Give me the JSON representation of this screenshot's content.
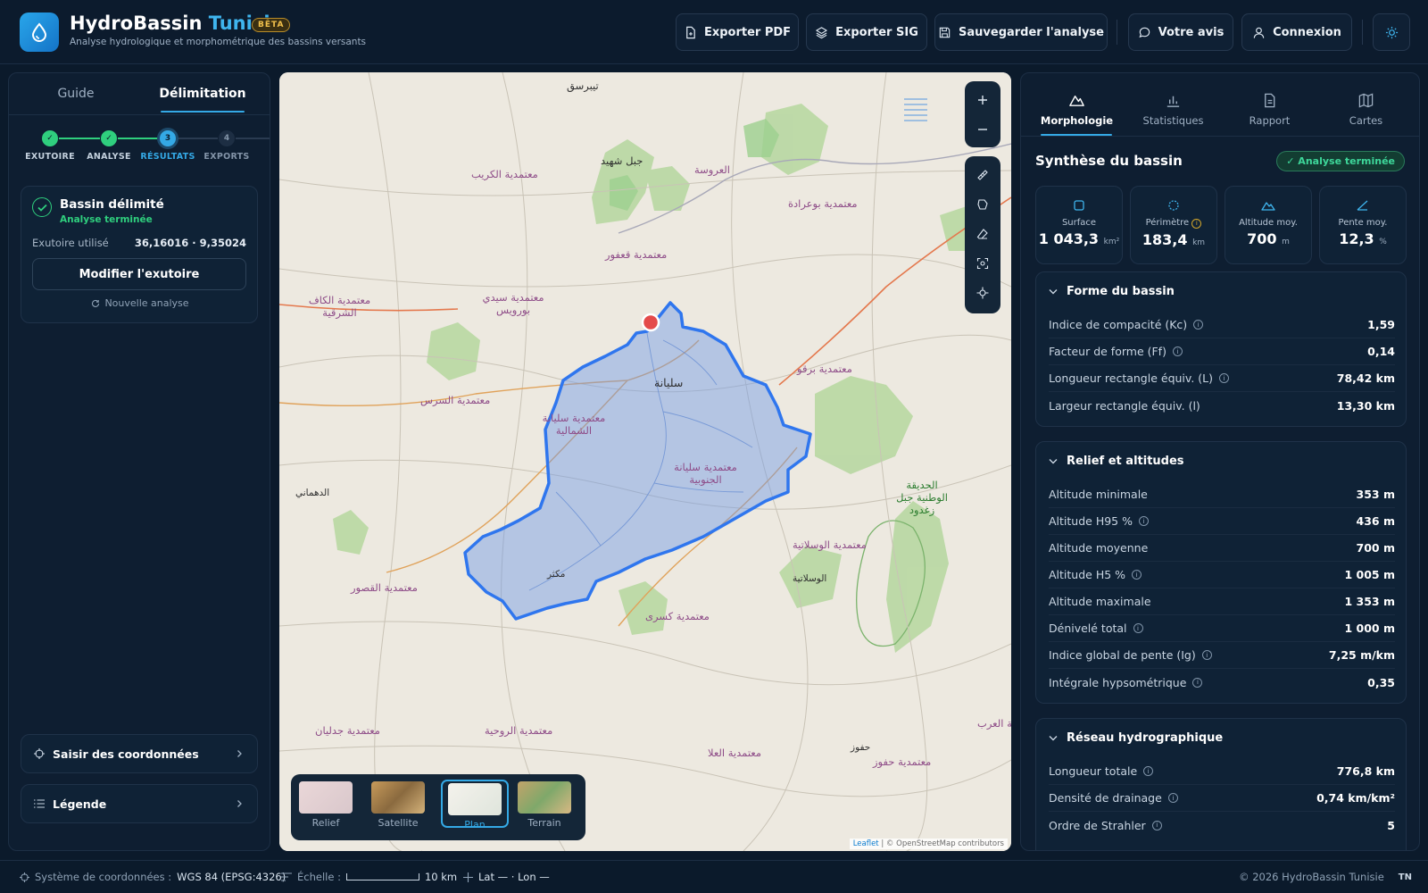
{
  "header": {
    "title_main": "HydroBassin",
    "title_accent": "Tunisie",
    "badge": "BÊTA",
    "subtitle": "Analyse hydrologique et morphométrique des bassins versants",
    "buttons": {
      "export_pdf": "Exporter PDF",
      "export_sig": "Exporter SIG",
      "save": "Sauvegarder l'analyse",
      "feedback": "Votre avis",
      "login": "Connexion"
    }
  },
  "left": {
    "tabs": [
      "Guide",
      "Délimitation"
    ],
    "steps": [
      {
        "n": "✓",
        "label": "EXUTOIRE"
      },
      {
        "n": "✓",
        "label": "ANALYSE"
      },
      {
        "n": "3",
        "label": "RÉSULTATS"
      },
      {
        "n": "4",
        "label": "EXPORTS"
      }
    ],
    "result": {
      "title": "Bassin délimité",
      "status": "Analyse terminée",
      "outlet_label": "Exutoire utilisé",
      "outlet_value": "36,16016 · 9,35024",
      "modify_button": "Modifier l'exutoire",
      "new_analysis": "Nouvelle analyse"
    },
    "coords_button": "Saisir des coordonnées",
    "legend_button": "Légende"
  },
  "map": {
    "labels": [
      "تيبرسق",
      "جبل شهيد",
      "العروسة",
      "معتمدية الكريب",
      "معتمدية بوعرادة",
      "معتمدية قعفور",
      "معتمدية سيدي بورويس",
      "معتمدية الكاف الشرقية",
      "سليانة",
      "معتمدية برقو",
      "معتمدية السرس",
      "معتمدية سليانة الشمالية",
      "معتمدية سليانة الجنوبية",
      "الدهماني",
      "الحديقة الوطنية جبل زغدود",
      "معتمدية الوسلاتية",
      "الوسلاتية",
      "مكثر",
      "معتمدية القصور",
      "معتمدية كسرى",
      "معتمدية جدليان",
      "معتمدية الروحية",
      "معتمدية العلا",
      "حفوز",
      "معتمدية حفوز",
      "معتمدية العرب"
    ],
    "basemaps": [
      "Relief",
      "Satellite",
      "Plan",
      "Terrain"
    ],
    "active_basemap": "Plan",
    "attribution_leaflet": "Leaflet",
    "attribution_osm": "| © OpenStreetMap contributors"
  },
  "right": {
    "tabs": [
      "Morphologie",
      "Statistiques",
      "Rapport",
      "Cartes"
    ],
    "title": "Synthèse du bassin",
    "badge": "✓ Analyse terminée",
    "stats": [
      {
        "label": "Surface",
        "value": "1 043,3",
        "unit": "km²"
      },
      {
        "label": "Périmètre",
        "value": "183,4",
        "unit": "km"
      },
      {
        "label": "Altitude moy.",
        "value": "700",
        "unit": "m"
      },
      {
        "label": "Pente moy.",
        "value": "12,3",
        "unit": "%"
      }
    ],
    "sections": [
      {
        "title": "Forme du bassin",
        "rows": [
          {
            "k": "Indice de compacité (Kc)",
            "v": "1,59"
          },
          {
            "k": "Facteur de forme (Ff)",
            "v": "0,14"
          },
          {
            "k": "Longueur rectangle équiv. (L)",
            "v": "78,42 km"
          },
          {
            "k": "Largeur rectangle équiv. (l)",
            "v": "13,30 km"
          }
        ]
      },
      {
        "title": "Relief et altitudes",
        "rows": [
          {
            "k": "Altitude minimale",
            "v": "353 m"
          },
          {
            "k": "Altitude H95 %",
            "v": "436 m"
          },
          {
            "k": "Altitude moyenne",
            "v": "700 m"
          },
          {
            "k": "Altitude H5 %",
            "v": "1 005 m"
          },
          {
            "k": "Altitude maximale",
            "v": "1 353 m"
          },
          {
            "k": "Dénivelé total",
            "v": "1 000 m"
          },
          {
            "k": "Indice global de pente (Ig)",
            "v": "7,25 m/km"
          },
          {
            "k": "Intégrale hypsométrique",
            "v": "0,35"
          }
        ]
      },
      {
        "title": "Réseau hydrographique",
        "rows": [
          {
            "k": "Longueur totale",
            "v": "776,8 km"
          },
          {
            "k": "Densité de drainage",
            "v": "0,74 km/km²"
          },
          {
            "k": "Ordre de Strahler",
            "v": "5"
          }
        ]
      }
    ]
  },
  "footer": {
    "crs_label": "Système de coordonnées :",
    "crs_value": "WGS 84 (EPSG:4326)",
    "scale_label": "Échelle :",
    "scale_value": "10 km",
    "latlon": "Lat — · Lon —",
    "copyright": "© 2026 HydroBassin Tunisie",
    "lang": "TN"
  }
}
